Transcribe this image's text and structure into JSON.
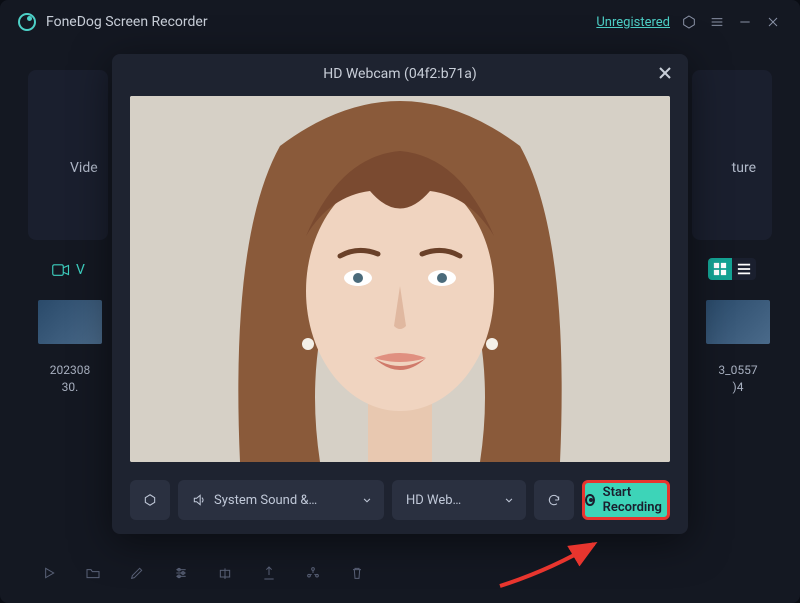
{
  "header": {
    "app_title": "FoneDog Screen Recorder",
    "unregistered": "Unregistered"
  },
  "background": {
    "left_card_label_fragment": "Vide",
    "right_card_label_fragment": "ture",
    "video_tab_fragment": "V"
  },
  "thumbnails": {
    "left": {
      "line1": "202308",
      "line2": "30."
    },
    "right": {
      "line1": "3_0557",
      "line2": ")4"
    }
  },
  "modal": {
    "title": "HD Webcam (04f2:b71a)",
    "audio_dropdown_label": "System Sound &…",
    "camera_dropdown_label": "HD Web…",
    "start_button_label": "Start Recording"
  }
}
